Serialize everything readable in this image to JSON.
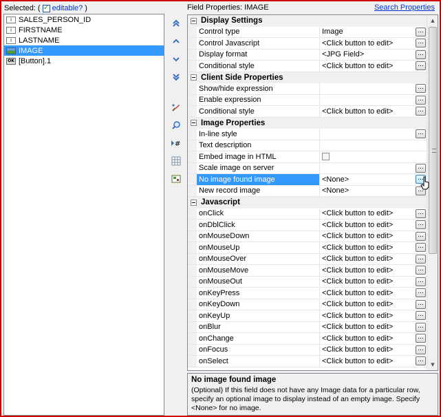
{
  "selected_panel": {
    "label_prefix": "Selected: (",
    "editable_checked": "✓",
    "editable_label": "editable?",
    "label_suffix": ")",
    "fields": [
      {
        "icon": "text-field-icon",
        "name": "SALES_PERSON_ID"
      },
      {
        "icon": "text-field-icon",
        "name": "FIRSTNAME"
      },
      {
        "icon": "text-field-icon",
        "name": "LASTNAME"
      },
      {
        "icon": "image-field-icon",
        "name": "IMAGE"
      },
      {
        "icon": "button-field-icon",
        "icon_text": "OK",
        "name": "[Button].1"
      }
    ]
  },
  "toolbar": {
    "move_top": "⌃",
    "move_up": "^",
    "move_down": "v",
    "move_bottom": "⌄",
    "icons": [
      "paint-brush-icon",
      "zoom-icon",
      "hash-icon",
      "grid-icon",
      "image-map-icon"
    ]
  },
  "properties": {
    "title": "Field Properties: IMAGE",
    "search_link": "Search Properties",
    "edit_button": "...",
    "categories": [
      {
        "name": "Display Settings",
        "rows": [
          {
            "name": "Control type",
            "value": "Image",
            "button": true
          },
          {
            "name": "Control Javascript",
            "value": "<Click button to edit>",
            "button": true
          },
          {
            "name": "Display format",
            "value": "<JPG Field>",
            "button": true
          },
          {
            "name": "Conditional style",
            "value": "<Click button to edit>",
            "button": true
          }
        ]
      },
      {
        "name": "Client Side Properties",
        "rows": [
          {
            "name": "Show/hide expression",
            "value": "",
            "button": true
          },
          {
            "name": "Enable expression",
            "value": "",
            "button": true
          },
          {
            "name": "Conditional style",
            "value": "<Click button to edit>",
            "button": true
          }
        ]
      },
      {
        "name": "Image Properties",
        "rows": [
          {
            "name": "In-line style",
            "value": "",
            "button": true
          },
          {
            "name": "Text description",
            "value": "",
            "button": false
          },
          {
            "name": "Embed image in HTML",
            "value": "",
            "checkbox": true,
            "button": false
          },
          {
            "name": "Scale image on server",
            "value": "",
            "button": true
          },
          {
            "name": "No image found image",
            "value": "<None>",
            "button": true,
            "selected": true
          },
          {
            "name": "New record image",
            "value": "<None>",
            "button": true
          }
        ]
      },
      {
        "name": "Javascript",
        "rows": [
          {
            "name": "onClick",
            "value": "<Click button to edit>",
            "button": true
          },
          {
            "name": "onDblClick",
            "value": "<Click button to edit>",
            "button": true
          },
          {
            "name": "onMouseDown",
            "value": "<Click button to edit>",
            "button": true
          },
          {
            "name": "onMouseUp",
            "value": "<Click button to edit>",
            "button": true
          },
          {
            "name": "onMouseOver",
            "value": "<Click button to edit>",
            "button": true
          },
          {
            "name": "onMouseMove",
            "value": "<Click button to edit>",
            "button": true
          },
          {
            "name": "onMouseOut",
            "value": "<Click button to edit>",
            "button": true
          },
          {
            "name": "onKeyPress",
            "value": "<Click button to edit>",
            "button": true
          },
          {
            "name": "onKeyDown",
            "value": "<Click button to edit>",
            "button": true
          },
          {
            "name": "onKeyUp",
            "value": "<Click button to edit>",
            "button": true
          },
          {
            "name": "onBlur",
            "value": "<Click button to edit>",
            "button": true
          },
          {
            "name": "onChange",
            "value": "<Click button to edit>",
            "button": true
          },
          {
            "name": "onFocus",
            "value": "<Click button to edit>",
            "button": true
          },
          {
            "name": "onSelect",
            "value": "<Click button to edit>",
            "button": true
          }
        ]
      }
    ]
  },
  "description": {
    "title": "No image found image",
    "body": "(Optional) If this field does not have any Image data for a particular row, specify an optional image to display instead of an empty image. Specify <None> for no image."
  },
  "colors": {
    "frame_border": "#cc0000",
    "selection": "#3399ff",
    "link": "#0033cc"
  }
}
